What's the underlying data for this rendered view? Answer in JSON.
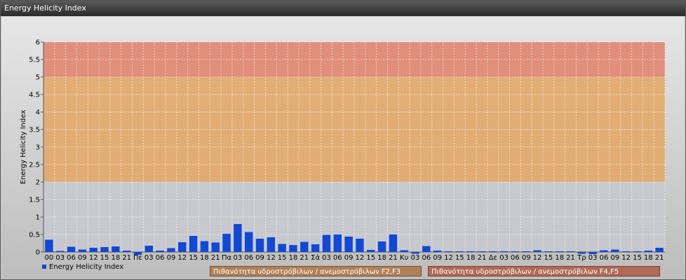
{
  "window": {
    "title": "Energy Helicity Index"
  },
  "chart_data": {
    "type": "bar",
    "ylabel": "Energy Helicity Index",
    "ylim": [
      0,
      6
    ],
    "yticks": [
      "0",
      "0.5",
      "1",
      "1.5",
      "2",
      "2.5",
      "3",
      "3.5",
      "4",
      "4.5",
      "5",
      "5.5",
      "6"
    ],
    "bands": [
      {
        "from": 0,
        "to": 2,
        "color": "#c6c9ce",
        "label": ""
      },
      {
        "from": 2,
        "to": 5,
        "color": "#e2a86a",
        "label": "Πιθανότητα υδροστρόβιλων / ανεμοστρόβιλων F2,F3"
      },
      {
        "from": 5,
        "to": 6,
        "color": "#e08670",
        "label": "Πιθανότητα υδροστρόβιλων / ανεμοστρόβιλων F4,F5"
      }
    ],
    "categories": [
      "00",
      "03",
      "06",
      "09",
      "12",
      "15",
      "18",
      "21",
      "Πε",
      "03",
      "06",
      "09",
      "12",
      "15",
      "18",
      "21",
      "Πα",
      "03",
      "06",
      "09",
      "12",
      "15",
      "18",
      "21",
      "Σά",
      "03",
      "06",
      "09",
      "12",
      "15",
      "18",
      "21",
      "Κυ",
      "03",
      "06",
      "09",
      "12",
      "15",
      "18",
      "21",
      "Δε",
      "03",
      "06",
      "09",
      "12",
      "15",
      "18",
      "21",
      "Τρ",
      "03",
      "06",
      "09",
      "12",
      "15",
      "18",
      "21"
    ],
    "series": [
      {
        "name": "Energy Helicity Index",
        "color": "#1048d8",
        "values": [
          0.35,
          0.03,
          0.15,
          0.07,
          0.12,
          0.14,
          0.16,
          0.04,
          -0.08,
          0.18,
          0.04,
          0.11,
          0.28,
          0.46,
          0.31,
          0.27,
          0.52,
          0.8,
          0.57,
          0.38,
          0.42,
          0.23,
          0.2,
          0.29,
          0.22,
          0.49,
          0.5,
          0.44,
          0.38,
          0.06,
          0.3,
          0.5,
          0.05,
          -0.05,
          0.17,
          0.04,
          0.02,
          0.02,
          0.02,
          0.02,
          0.02,
          0.02,
          0.02,
          0.02,
          0.05,
          0.02,
          0.02,
          0.02,
          -0.05,
          -0.06,
          0.05,
          0.07,
          0.02,
          0.02,
          0.04,
          0.12
        ]
      }
    ]
  }
}
